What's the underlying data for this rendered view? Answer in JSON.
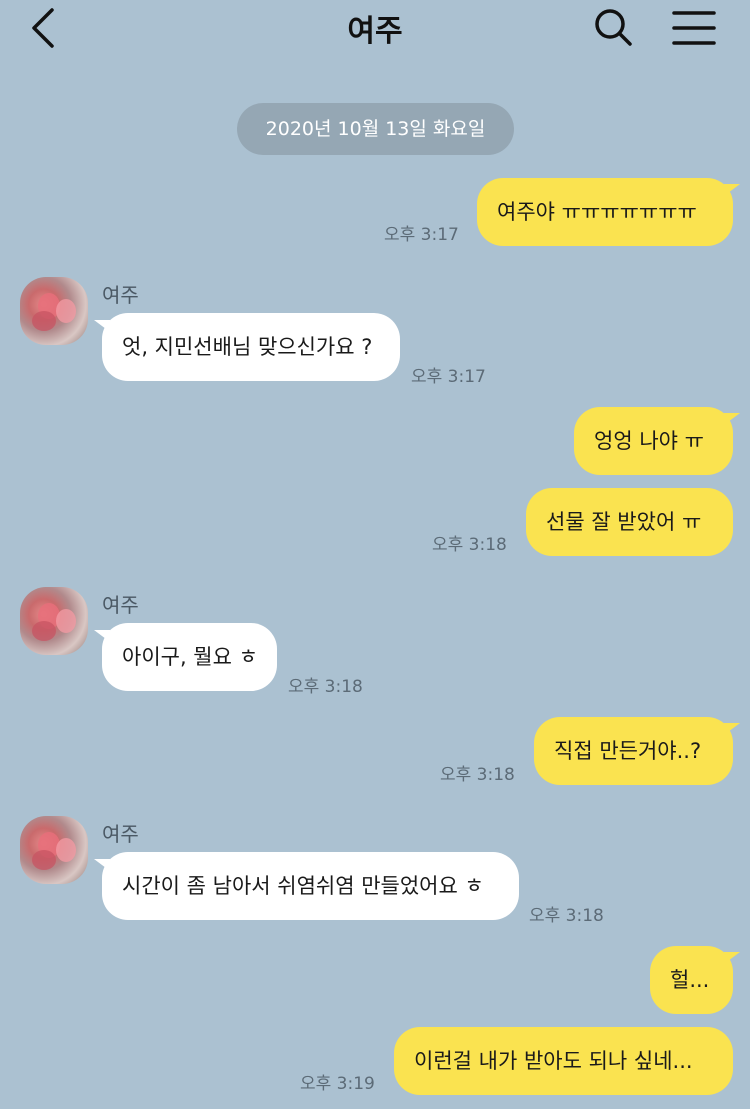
{
  "header": {
    "title": "여주",
    "back_icon": "chevron-left-icon",
    "search_icon": "search-icon",
    "menu_icon": "hamburger-menu-icon"
  },
  "date_divider": "2020년 10월 13일 화요일",
  "colors": {
    "background": "#abc1d1",
    "my_bubble": "#fae350",
    "their_bubble": "#ffffff",
    "date_pill": "#95a7b4"
  },
  "messages": [
    {
      "from": "me",
      "text": "여주야 ㅠㅠㅠㅠㅠㅠㅠ",
      "time": "오후 3:17"
    },
    {
      "from": "them",
      "sender": "여주",
      "text": "엇, 지민선배님 맞으신가요 ?",
      "time": "오후 3:17"
    },
    {
      "from": "me",
      "text": "엉엉 나야 ㅠ",
      "time": ""
    },
    {
      "from": "me",
      "text": "선물 잘 받았어 ㅠ",
      "time": "오후 3:18"
    },
    {
      "from": "them",
      "sender": "여주",
      "text": "아이구, 뭘요 ㅎ",
      "time": "오후 3:18"
    },
    {
      "from": "me",
      "text": "직접 만든거야..?",
      "time": "오후 3:18"
    },
    {
      "from": "them",
      "sender": "여주",
      "text": "시간이 좀 남아서 쉬염쉬염 만들었어요 ㅎ",
      "time": "오후 3:18"
    },
    {
      "from": "me",
      "text": "헐...",
      "time": ""
    },
    {
      "from": "me",
      "text": "이런걸 내가 받아도 되나 싶네...",
      "time": "오후 3:19"
    }
  ]
}
